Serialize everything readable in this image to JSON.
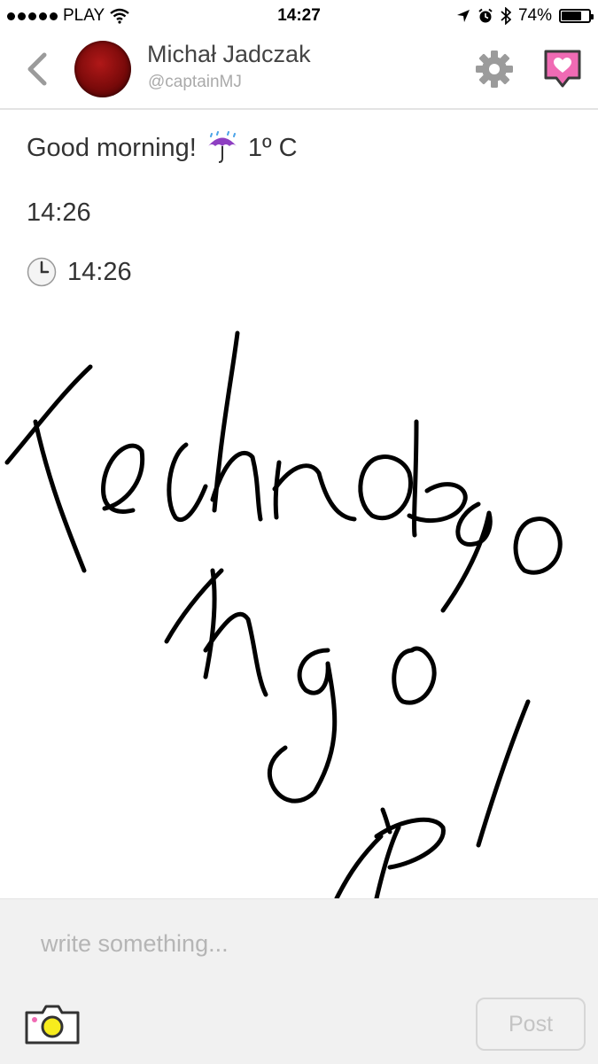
{
  "status_bar": {
    "carrier": "PLAY",
    "time": "14:27",
    "battery_percent": "74%",
    "battery_level": 0.74
  },
  "header": {
    "name": "Michał Jadczak",
    "handle": "@captainMJ",
    "accent_color": "#f06bb4"
  },
  "post": {
    "greeting": "Good morning!",
    "weather_icon": "umbrella-with-rain-icon",
    "temperature": "1º C",
    "time": "14:26",
    "clock_icon": "clock-icon",
    "clock_time": "14:26"
  },
  "composer": {
    "placeholder": "write something...",
    "post_label": "Post"
  }
}
